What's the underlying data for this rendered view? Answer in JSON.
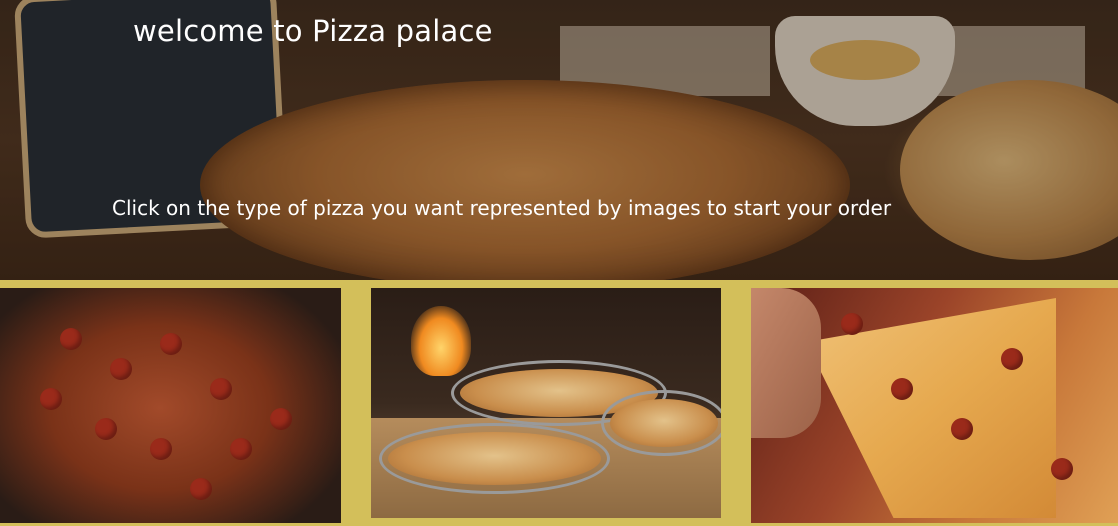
{
  "hero": {
    "title": "welcome to Pizza palace",
    "subtitle": "Click on the type of pizza you want represented by images to start your order"
  },
  "pizza_options": [
    {
      "image": "pepperoni-pizza-photo"
    },
    {
      "image": "wood-fired-pizzas-photo"
    },
    {
      "image": "pizza-slice-photo"
    }
  ],
  "colors": {
    "page_background": "#d3bf5a",
    "heading_text": "#ffffff"
  }
}
